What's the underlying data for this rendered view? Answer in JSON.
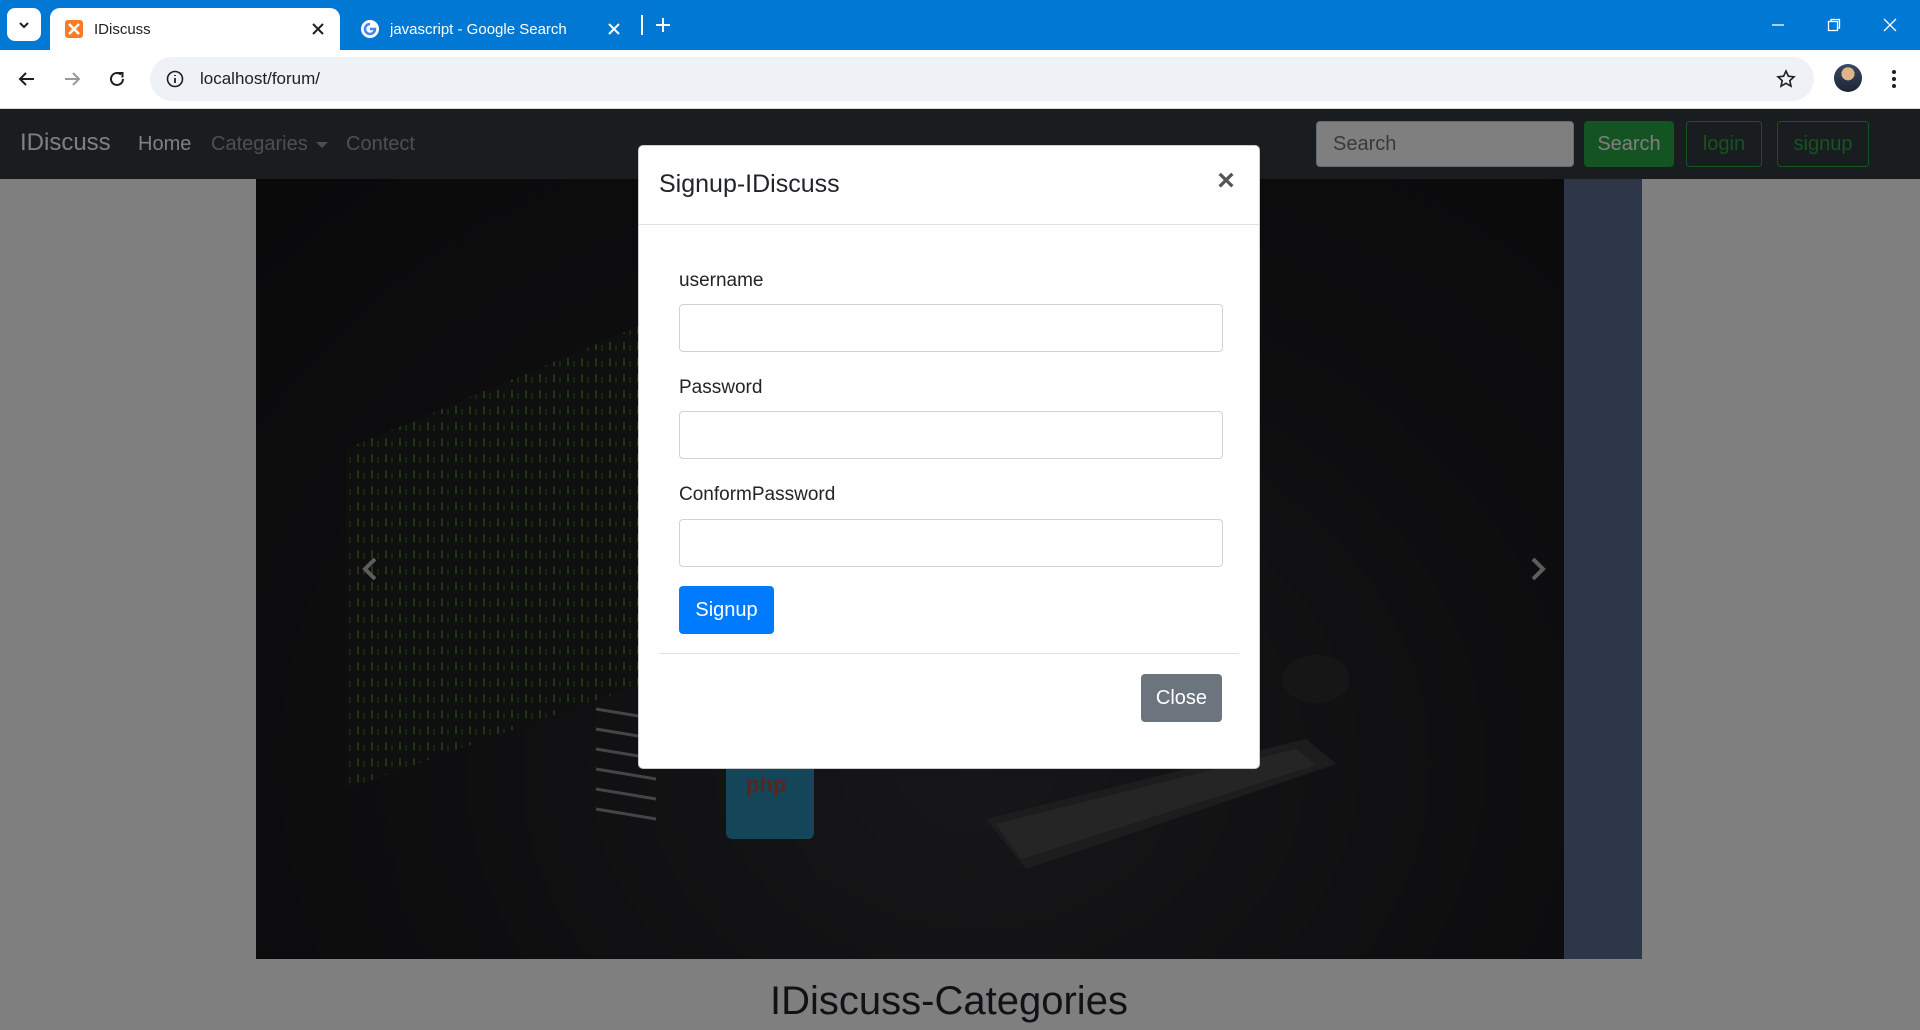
{
  "browser": {
    "tabs": [
      {
        "title": "IDiscuss",
        "active": true
      },
      {
        "title": "javascript - Google Search",
        "active": false
      }
    ],
    "url": "localhost/forum/"
  },
  "site": {
    "brand": "IDiscuss",
    "nav": {
      "home": "Home",
      "categories": "Categaries",
      "contact": "Contect"
    },
    "search_placeholder": "Search",
    "search_button": "Search",
    "login_button": "login",
    "signup_button": "signup"
  },
  "carousel": {
    "badge_text": "php"
  },
  "section_heading": "IDiscuss-Categories",
  "modal": {
    "title": "Signup-IDiscuss",
    "close_x": "×",
    "fields": [
      {
        "label": "username",
        "value": ""
      },
      {
        "label": "Password",
        "value": ""
      },
      {
        "label": "ConformPassword",
        "value": ""
      }
    ],
    "submit_label": "Signup",
    "close_label": "Close"
  },
  "colors": {
    "tabbar": "#0078d4",
    "navbar": "#343a40",
    "success": "#28a745",
    "primary": "#007bff",
    "secondary": "#6c757d"
  }
}
